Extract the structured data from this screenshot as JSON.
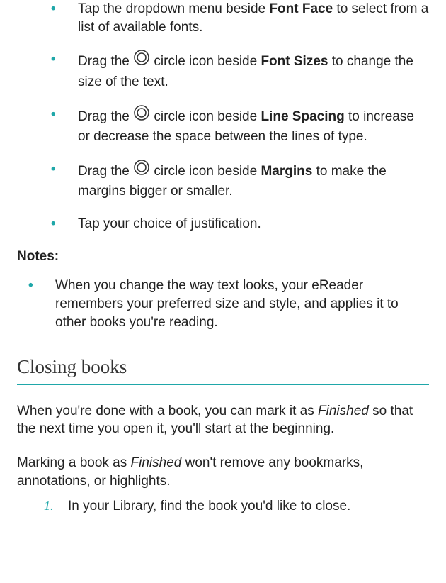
{
  "instructions": {
    "items": [
      {
        "pre": "Tap the dropdown menu beside ",
        "bold": "Font Face",
        "post": " to select from a list of available fonts.",
        "has_icon": false
      },
      {
        "pre": "Drag the ",
        "mid": " circle icon beside ",
        "bold": "Font Sizes",
        "post": " to change the size of the text.",
        "has_icon": true
      },
      {
        "pre": "Drag the ",
        "mid": " circle icon beside ",
        "bold": "Line Spacing",
        "post": " to increase or decrease the space between the lines of type.",
        "has_icon": true
      },
      {
        "pre": "Drag the ",
        "mid": " circle icon beside ",
        "bold": "Margins",
        "post": " to make the margins bigger or smaller.",
        "has_icon": true
      },
      {
        "pre": "Tap your choice of justification.",
        "has_icon": false
      }
    ]
  },
  "notes_label_pre": "Notes",
  "notes_label_post": ":",
  "notes": {
    "items": [
      "When you change the way text looks, your eReader remembers your preferred size and style, and applies it to other books you're reading."
    ]
  },
  "section_heading": "Closing books",
  "para1": {
    "pre": "When you're done with a book, you can mark it as ",
    "italic": "Finished",
    "post": " so that the next time you open it, you'll start at the beginning."
  },
  "para2": {
    "pre": "Marking a book as ",
    "italic": "Finished",
    "post": " won't remove any bookmarks, annotations, or highlights."
  },
  "steps": {
    "items": [
      "In your Library, find the book you'd like to close."
    ]
  }
}
